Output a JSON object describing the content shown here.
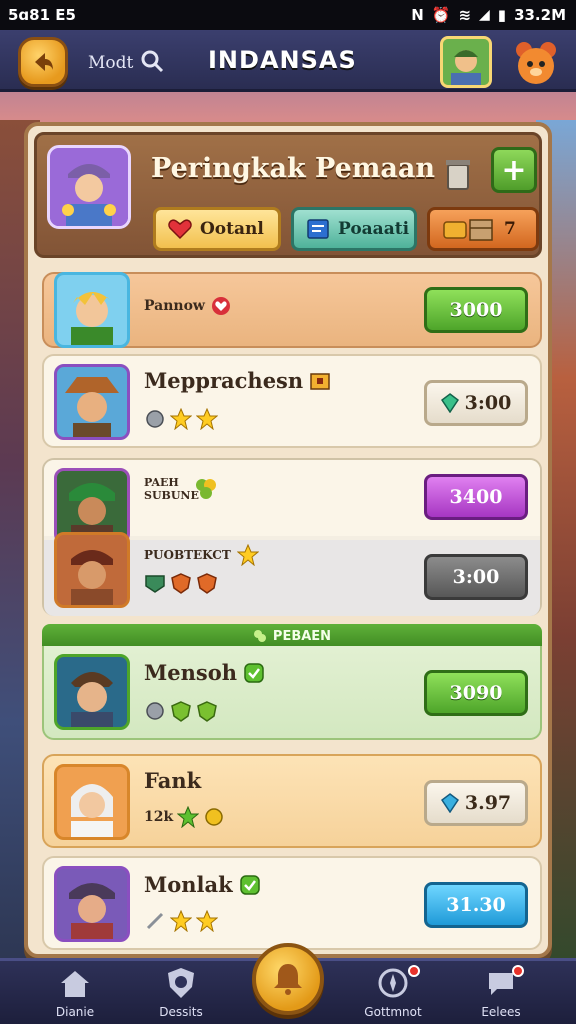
{
  "status_bar": {
    "time": "5ɑ81 E5",
    "clock_right": "33.2M"
  },
  "header": {
    "mode_label": "Modt",
    "title": "INDANSAS"
  },
  "panel": {
    "title": "Peringkak Pemaan",
    "chips": [
      {
        "label": "Ootanl",
        "icon": "heart-icon"
      },
      {
        "label": "Poaaati",
        "icon": "card-icon"
      },
      {
        "label": "7",
        "icon": "chest-icon"
      }
    ]
  },
  "rows": [
    {
      "name": "Pannow",
      "score": "3000"
    },
    {
      "name": "Mepprachesn",
      "score": "3:00"
    },
    {
      "name": "PAEH SUBUNE",
      "score": "3400"
    },
    {
      "name": "PUOBTEKCT",
      "score": "3:00"
    },
    {
      "name": "Mensoh",
      "score": "3090"
    },
    {
      "name": "Fank",
      "tag": "12k",
      "score": "3.97"
    },
    {
      "name": "Monlak",
      "score": "31.30"
    }
  ],
  "section_banner": "PEBAEN",
  "bottom_nav": [
    {
      "label": "Dianie",
      "icon": "home-icon"
    },
    {
      "label": "Dessits",
      "icon": "shield-icon"
    },
    {
      "label": "",
      "icon": "bell-icon"
    },
    {
      "label": "Gottmnot",
      "icon": "compass-icon"
    },
    {
      "label": "Eelees",
      "icon": "chat-icon"
    }
  ],
  "colors": {
    "accent_gold": "#e79a1e",
    "panel_bg": "#f3e4cd",
    "green": "#4ea52a",
    "purple": "#a636c2",
    "blue": "#1f9ad8"
  }
}
